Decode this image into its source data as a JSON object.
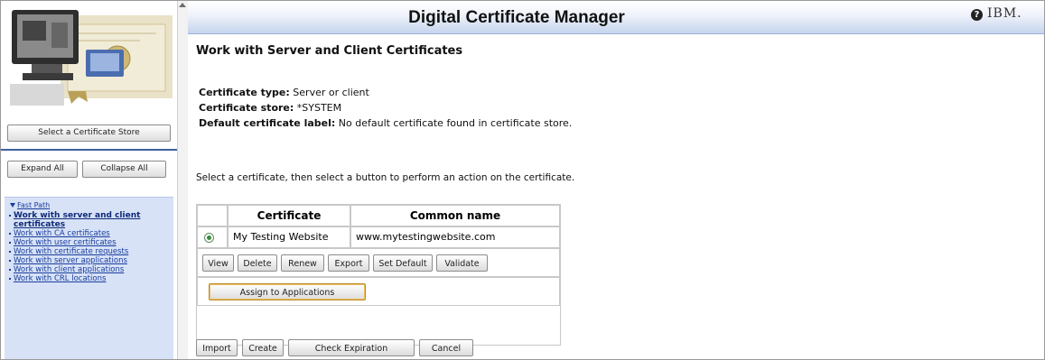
{
  "app": {
    "title": "Digital Certificate Manager",
    "brand": "IBM.",
    "help_symbol": "?"
  },
  "left_nav": {
    "select_store_label": "Select a Certificate Store",
    "expand_all_label": "Expand All",
    "collapse_all_label": "Collapse All",
    "fast_path_label": "Fast Path",
    "items": [
      {
        "label": "Work with server and client certificates",
        "active": true
      },
      {
        "label": "Work with CA certificates",
        "active": false
      },
      {
        "label": "Work with user certificates",
        "active": false
      },
      {
        "label": "Work with certificate requests",
        "active": false
      },
      {
        "label": "Work with server applications",
        "active": false
      },
      {
        "label": "Work with client applications",
        "active": false
      },
      {
        "label": "Work with CRL locations",
        "active": false
      }
    ]
  },
  "page": {
    "title": "Work with Server and Client Certificates",
    "info": [
      {
        "key": "Certificate type:",
        "value": "Server or client"
      },
      {
        "key": "Certificate store:",
        "value": "*SYSTEM"
      },
      {
        "key": "Default certificate label:",
        "value": "No default certificate found in certificate store."
      }
    ],
    "instruction": "Select a certificate, then select a button to perform an action on the certificate."
  },
  "table": {
    "columns": [
      "Certificate",
      "Common name"
    ],
    "rows": [
      {
        "certificate": "My Testing Website",
        "common_name": "www.mytestingwebsite.com",
        "selected": true
      }
    ],
    "actions": [
      "View",
      "Delete",
      "Renew",
      "Export",
      "Set Default",
      "Validate"
    ],
    "assign_label": "Assign to Applications"
  },
  "footer_actions": [
    "Import",
    "Create",
    "Check Expiration",
    "Cancel"
  ],
  "colors": {
    "nav_panel": "#d7e2f7",
    "link": "#1a3d9c",
    "header_gradient_end": "#c5d4ee"
  },
  "icons": {
    "logo": "certificate-computer-illustration",
    "help": "help-icon",
    "scroll_up": "scroll-up-arrow-icon"
  }
}
